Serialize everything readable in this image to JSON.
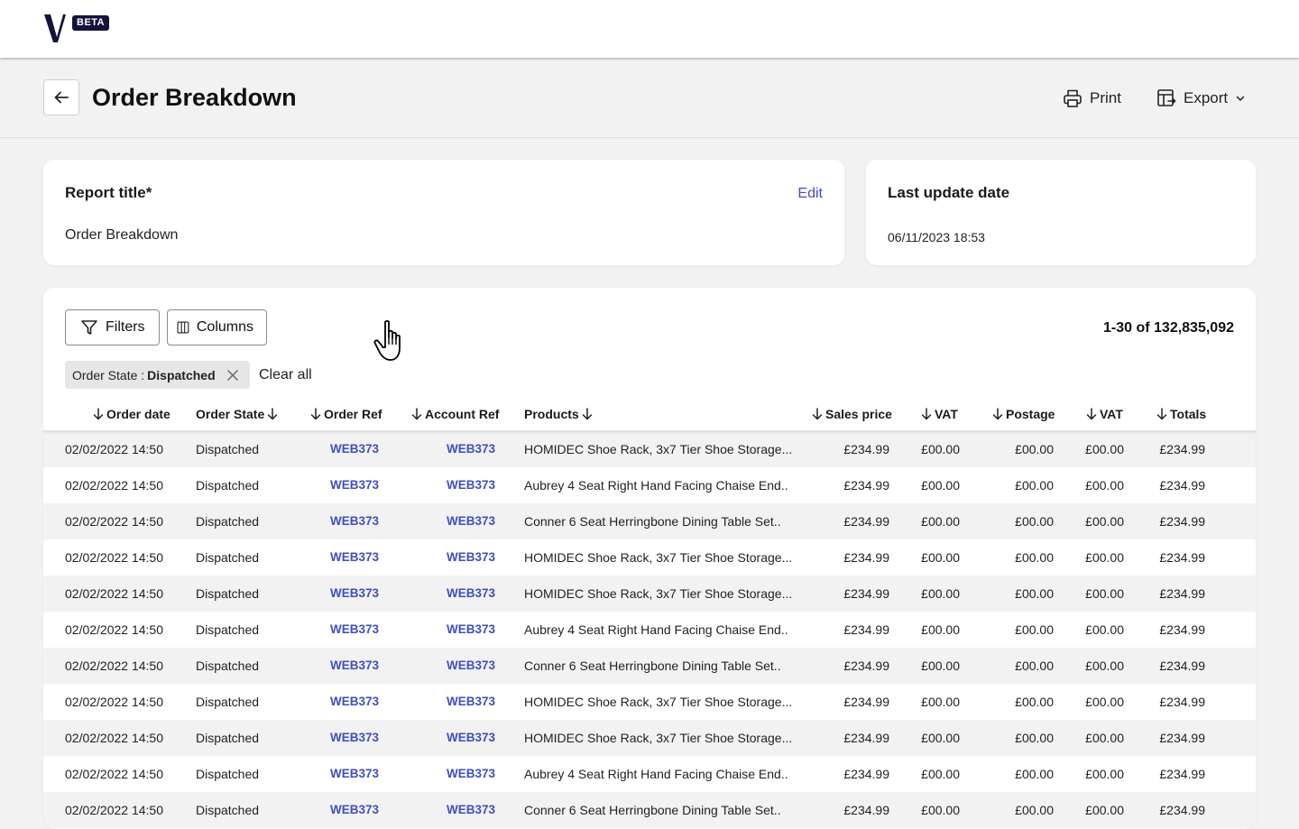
{
  "brand": {
    "logo_letter": "V",
    "badge": "BETA",
    "colors": {
      "navy": "#14143a",
      "link": "#3f4ec9"
    }
  },
  "header": {
    "title": "Order Breakdown",
    "back_icon": "arrow-left-icon",
    "actions": {
      "print_label": "Print",
      "export_label": "Export"
    }
  },
  "report_card": {
    "label": "Report title*",
    "value": "Order Breakdown",
    "edit_label": "Edit"
  },
  "update_card": {
    "label": "Last update date",
    "value": "06/11/2023 18:53"
  },
  "toolbar": {
    "filters_label": "Filters",
    "columns_label": "Columns",
    "range_label": "1-30 of 132,835,092"
  },
  "active_filter": {
    "key": "Order State :",
    "value": "Dispatched",
    "clear_all_label": "Clear all"
  },
  "table": {
    "columns": [
      "Order date",
      "Order State",
      "Order Ref",
      "Account Ref",
      "Products",
      "Sales price",
      "VAT",
      "Postage",
      "VAT",
      "Totals"
    ],
    "rows": [
      [
        "02/02/2022 14:50",
        "Dispatched",
        "WEB373",
        "WEB373",
        "HOMIDEC Shoe Rack, 3x7 Tier Shoe Storage...",
        "£234.99",
        "£00.00",
        "£00.00",
        "£00.00",
        "£234.99"
      ],
      [
        "02/02/2022 14:50",
        "Dispatched",
        "WEB373",
        "WEB373",
        "Aubrey 4 Seat Right Hand Facing Chaise End..",
        "£234.99",
        "£00.00",
        "£00.00",
        "£00.00",
        "£234.99"
      ],
      [
        "02/02/2022 14:50",
        "Dispatched",
        "WEB373",
        "WEB373",
        "Conner 6 Seat Herringbone Dining Table Set..",
        "£234.99",
        "£00.00",
        "£00.00",
        "£00.00",
        "£234.99"
      ],
      [
        "02/02/2022 14:50",
        "Dispatched",
        "WEB373",
        "WEB373",
        "HOMIDEC Shoe Rack, 3x7 Tier Shoe Storage...",
        "£234.99",
        "£00.00",
        "£00.00",
        "£00.00",
        "£234.99"
      ],
      [
        "02/02/2022 14:50",
        "Dispatched",
        "WEB373",
        "WEB373",
        "HOMIDEC Shoe Rack, 3x7 Tier Shoe Storage...",
        "£234.99",
        "£00.00",
        "£00.00",
        "£00.00",
        "£234.99"
      ],
      [
        "02/02/2022 14:50",
        "Dispatched",
        "WEB373",
        "WEB373",
        "Aubrey 4 Seat Right Hand Facing Chaise End..",
        "£234.99",
        "£00.00",
        "£00.00",
        "£00.00",
        "£234.99"
      ],
      [
        "02/02/2022 14:50",
        "Dispatched",
        "WEB373",
        "WEB373",
        "Conner 6 Seat Herringbone Dining Table Set..",
        "£234.99",
        "£00.00",
        "£00.00",
        "£00.00",
        "£234.99"
      ],
      [
        "02/02/2022 14:50",
        "Dispatched",
        "WEB373",
        "WEB373",
        "HOMIDEC Shoe Rack, 3x7 Tier Shoe Storage...",
        "£234.99",
        "£00.00",
        "£00.00",
        "£00.00",
        "£234.99"
      ],
      [
        "02/02/2022 14:50",
        "Dispatched",
        "WEB373",
        "WEB373",
        "HOMIDEC Shoe Rack, 3x7 Tier Shoe Storage...",
        "£234.99",
        "£00.00",
        "£00.00",
        "£00.00",
        "£234.99"
      ],
      [
        "02/02/2022 14:50",
        "Dispatched",
        "WEB373",
        "WEB373",
        "Aubrey 4 Seat Right Hand Facing Chaise End..",
        "£234.99",
        "£00.00",
        "£00.00",
        "£00.00",
        "£234.99"
      ],
      [
        "02/02/2022 14:50",
        "Dispatched",
        "WEB373",
        "WEB373",
        "Conner 6 Seat Herringbone Dining Table Set..",
        "£234.99",
        "£00.00",
        "£00.00",
        "£00.00",
        "£234.99"
      ]
    ]
  }
}
